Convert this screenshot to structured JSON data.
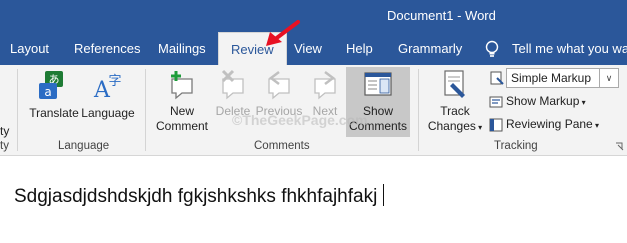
{
  "window": {
    "title": "Document1  -  Word"
  },
  "tabs": [
    {
      "label": "Layout"
    },
    {
      "label": "References"
    },
    {
      "label": "Mailings"
    },
    {
      "label": "Review"
    },
    {
      "label": "View"
    },
    {
      "label": "Help"
    },
    {
      "label": "Grammarly"
    }
  ],
  "tell_me": {
    "label": "Tell me what you wan",
    "icon": "lightbulb-icon"
  },
  "ribbon": {
    "partial_left_top": "ty",
    "partial_left_bottom": "ty",
    "language_group": {
      "label": "Language",
      "translate": "Translate",
      "language": "Language"
    },
    "comments_group": {
      "label": "Comments",
      "new_line1": "New",
      "new_line2": "Comment",
      "delete": "Delete",
      "previous": "Previous",
      "next": "Next",
      "show_line1": "Show",
      "show_line2": "Comments"
    },
    "tracking_group": {
      "label": "Tracking",
      "track_line1": "Track",
      "track_line2": "Changes",
      "markup_select": "Simple Markup",
      "show_markup": "Show Markup",
      "reviewing_pane": "Reviewing Pane"
    }
  },
  "document": {
    "text": "Sdgjasdjdshdskjdh fgkjshkshks fhkhfajhfakj"
  },
  "watermark": "©TheGeekPage.com",
  "colors": {
    "brand": "#2b579a",
    "ribbon_bg": "#f3f3f3",
    "annotation_arrow": "#e81123"
  }
}
